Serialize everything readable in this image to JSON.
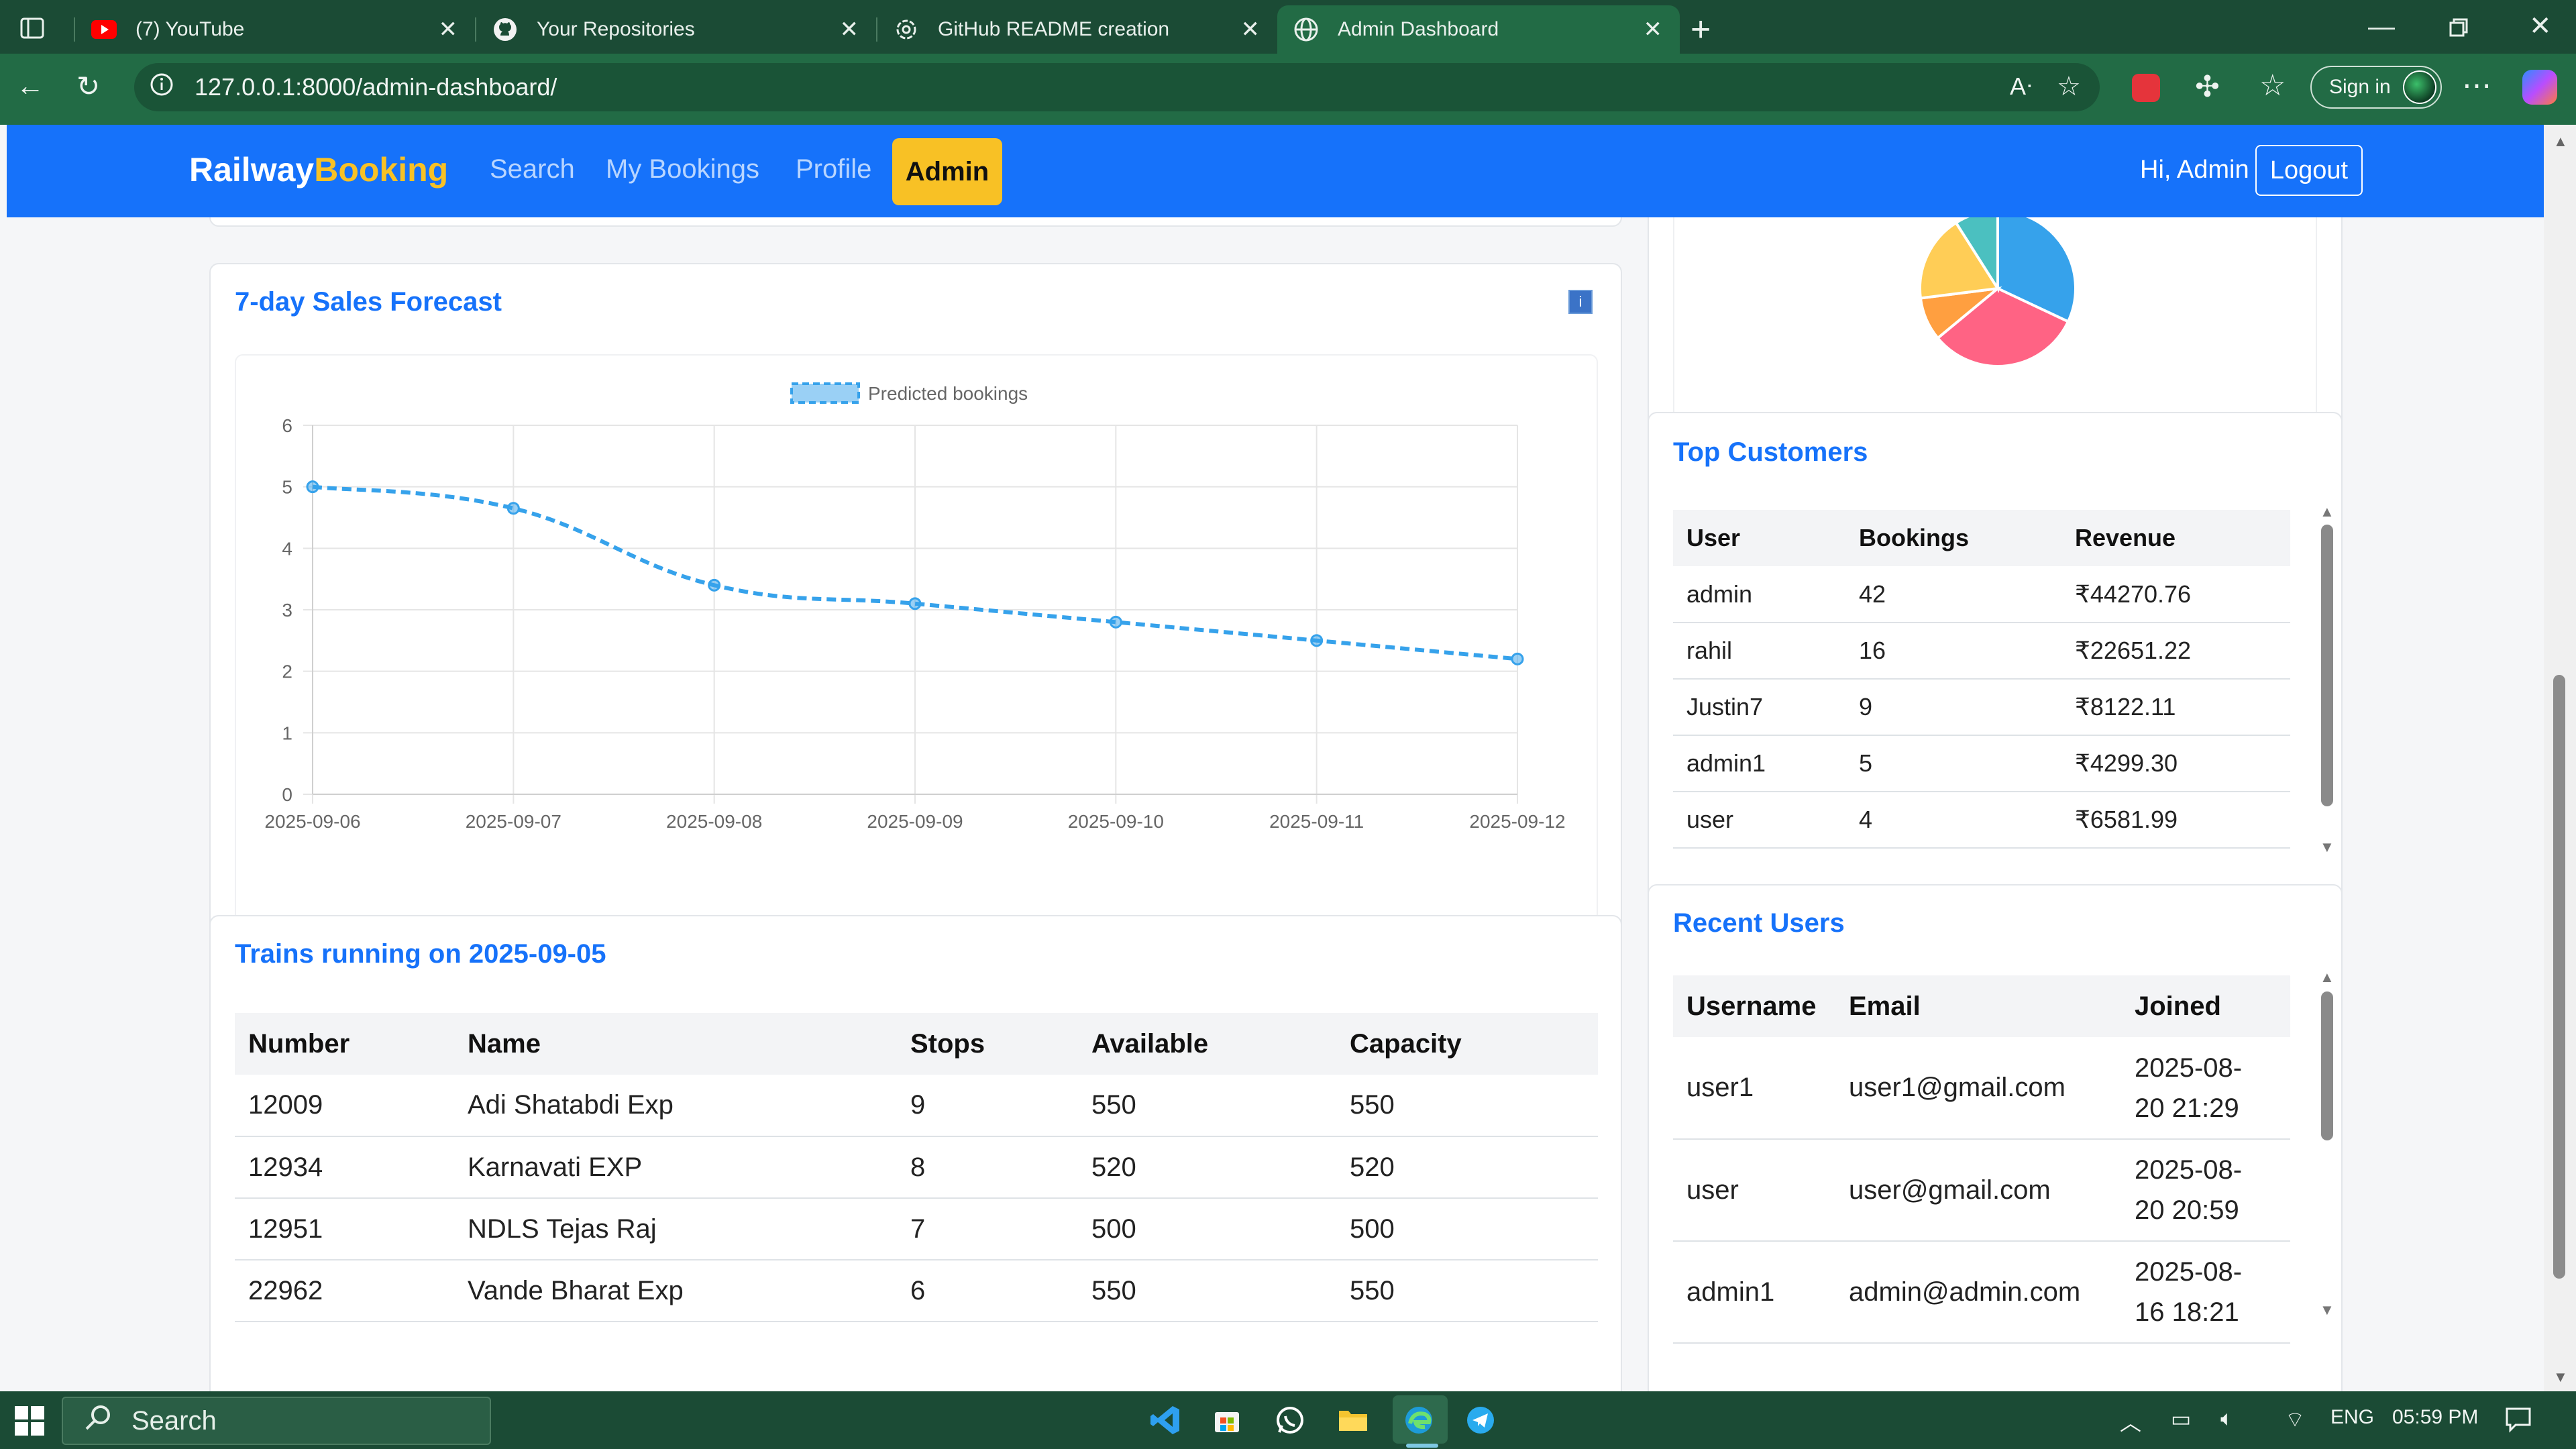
{
  "browser": {
    "tabs": [
      {
        "label": "(7) YouTube",
        "icon": "youtube-icon"
      },
      {
        "label": "Your Repositories",
        "icon": "github-icon"
      },
      {
        "label": "GitHub README creation",
        "icon": "chatgpt-icon"
      },
      {
        "label": "Admin Dashboard",
        "icon": "globe-icon",
        "active": true
      }
    ],
    "url": "127.0.0.1:8000/admin-dashboard/",
    "signin_label": "Sign in"
  },
  "navbar": {
    "brand_part1": "Railway",
    "brand_part2": "Booking",
    "links": [
      "Search",
      "My Bookings",
      "Profile"
    ],
    "active_link": "Admin",
    "greeting": "Hi, Admin",
    "logout_label": "Logout"
  },
  "forecast": {
    "title": "7-day Sales Forecast",
    "info_label": "i",
    "chart_data": {
      "type": "line",
      "legend_position": "top",
      "x": [
        "2025-09-06",
        "2025-09-07",
        "2025-09-08",
        "2025-09-09",
        "2025-09-10",
        "2025-09-11",
        "2025-09-12"
      ],
      "series": [
        {
          "name": "Predicted bookings",
          "values": [
            5.0,
            4.65,
            3.4,
            3.1,
            2.8,
            2.5,
            2.2
          ],
          "color": "#36a2eb",
          "dashed": true
        }
      ],
      "yticks": [
        "0",
        "1",
        "2",
        "3",
        "4",
        "5",
        "6"
      ],
      "ylim": [
        0,
        6
      ],
      "grid": true
    }
  },
  "pie_chart": {
    "chart_data": {
      "type": "pie",
      "slices": [
        {
          "value": 32,
          "color": "#36a2eb"
        },
        {
          "value": 32,
          "color": "#ff6384"
        },
        {
          "value": 9,
          "color": "#ff9f40"
        },
        {
          "value": 18,
          "color": "#ffcd56"
        },
        {
          "value": 9,
          "color": "#4bc0c0"
        }
      ]
    }
  },
  "trains": {
    "title": "Trains running on 2025-09-05",
    "headers": [
      "Number",
      "Name",
      "Stops",
      "Available",
      "Capacity"
    ],
    "rows": [
      [
        "12009",
        "Adi Shatabdi Exp",
        "9",
        "550",
        "550"
      ],
      [
        "12934",
        "Karnavati EXP",
        "8",
        "520",
        "520"
      ],
      [
        "12951",
        "NDLS Tejas Raj",
        "7",
        "500",
        "500"
      ],
      [
        "22962",
        "Vande Bharat Exp",
        "6",
        "550",
        "550"
      ]
    ]
  },
  "top_customers": {
    "title": "Top Customers",
    "headers": [
      "User",
      "Bookings",
      "Revenue"
    ],
    "rows": [
      [
        "admin",
        "42",
        "₹44270.76"
      ],
      [
        "rahil",
        "16",
        "₹22651.22"
      ],
      [
        "Justin7",
        "9",
        "₹8122.11"
      ],
      [
        "admin1",
        "5",
        "₹4299.30"
      ],
      [
        "user",
        "4",
        "₹6581.99"
      ]
    ]
  },
  "recent_users": {
    "title": "Recent Users",
    "headers": [
      "Username",
      "Email",
      "Joined"
    ],
    "rows": [
      [
        "user1",
        "user1@gmail.com",
        "2025-08-",
        "20 21:29"
      ],
      [
        "user",
        "user@gmail.com",
        "2025-08-",
        "20 20:59"
      ],
      [
        "admin1",
        "admin@admin.com",
        "2025-08-",
        "16 18:21"
      ]
    ]
  },
  "taskbar": {
    "search_label": "Search",
    "language": "ENG",
    "time": "05:59 PM"
  }
}
